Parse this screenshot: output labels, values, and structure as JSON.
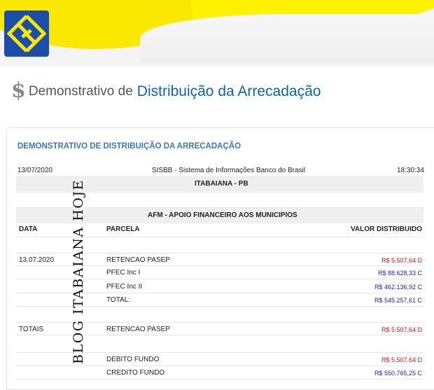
{
  "header": {
    "title_prefix": "Demonstrativo de",
    "title_main": "Distribuição da Arrecadação"
  },
  "report": {
    "section_title": "DEMONSTRATIVO DE DISTRIBUIÇÃO DA ARRECADAÇÃO",
    "date": "13/07/2020",
    "system": "SISBB - Sistema de Informações Banco do Brasil",
    "time": "18:30:34",
    "municipality": "ITABAIANA - PB",
    "program": "AFM - APOIO FINANCEIRO AOS MUNICIPIOS",
    "columns": {
      "date": "DATA",
      "parcel": "PARCELA",
      "value": "VALOR DISTRIBUIDO"
    },
    "entries": [
      {
        "date": "13.07.2020",
        "parcel": "RETENCAO PASEP",
        "value": "R$ 5.507,64 D",
        "color": "#dd1111"
      },
      {
        "date": "",
        "parcel": "PFEC Inc I",
        "value": "R$ 88.628,33 C",
        "color": "#1a1ad6"
      },
      {
        "date": "",
        "parcel": "PFEC Inc II",
        "value": "R$ 462.136,92 C",
        "color": "#1a1ad6"
      },
      {
        "date": "",
        "parcel": "TOTAL:",
        "value": "R$ 545.257,61 C",
        "color": "#1a1ad6"
      }
    ],
    "totals": {
      "label": "TOTAIS",
      "retencao_parcel": "RETENCAO PASEP",
      "retencao_value": "R$ 5.507,64 D",
      "debito_parcel": "DEBITO FUNDO",
      "debito_value": "R$ 5.507,64 D",
      "credito_parcel": "CREDITO FUNDO",
      "credito_value": "R$ 550.765,25 C"
    }
  },
  "watermark": "BLOG ITABAIANA HOJE",
  "colors": {
    "brand_blue": "#1b4dab",
    "brand_yellow": "#fbe800",
    "title_blue": "#0b64b0",
    "section_blue": "#3b78b8",
    "debit_red": "#dd1111",
    "credit_blue": "#1a1ad6"
  },
  "icons": {
    "logo": "banco-do-brasil-logo",
    "title_icon": "dollar-sign-icon"
  }
}
